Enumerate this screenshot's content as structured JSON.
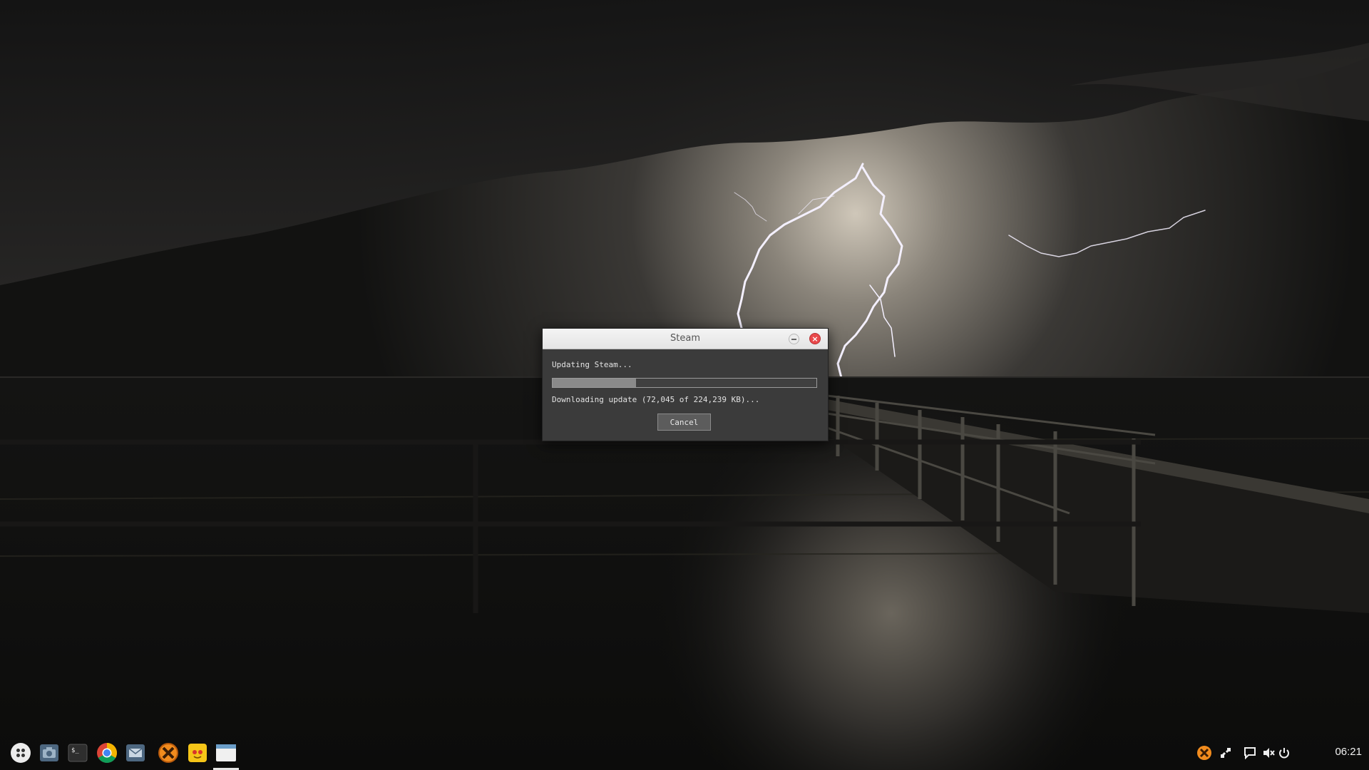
{
  "dialog": {
    "title": "Steam",
    "status": "Updating Steam...",
    "progress_fraction": 0.316,
    "download": "Downloading update (72,045 of 224,239 KB)...",
    "cancel_label": "Cancel"
  },
  "taskbar": {
    "apps": [
      {
        "name": "launcher-icon"
      },
      {
        "name": "camera-app-icon"
      },
      {
        "name": "terminal-icon"
      },
      {
        "name": "chrome-icon"
      },
      {
        "name": "mail-icon"
      },
      {
        "name": "crossover-icon"
      },
      {
        "name": "yellow-app-icon"
      },
      {
        "name": "window-app-icon"
      }
    ],
    "tray": [
      "crossover-tray-icon",
      "network-icon",
      "chat-icon",
      "volume-muted-icon",
      "power-icon"
    ],
    "clock": "06:21"
  },
  "colors": {
    "close_button": "#e9484a",
    "dialog_bg": "#3b3b3b",
    "crossover_orange": "#f28c1e",
    "yellow_app": "#f5c518"
  }
}
